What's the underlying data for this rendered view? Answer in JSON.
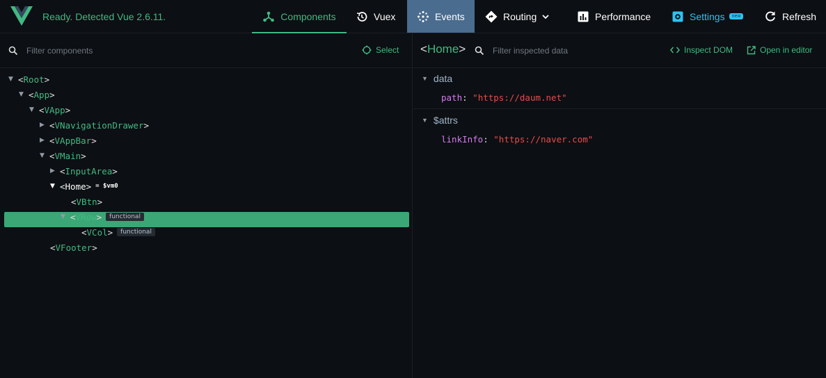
{
  "app": {
    "status": "Ready. Detected Vue 2.6.11."
  },
  "tabs": {
    "components": "Components",
    "vuex": "Vuex",
    "events": "Events",
    "routing": "Routing",
    "performance": "Performance",
    "settings": "Settings",
    "settings_badge": "new",
    "refresh": "Refresh"
  },
  "tree_panel": {
    "filter_placeholder": "Filter components",
    "select_label": "Select"
  },
  "tree": [
    {
      "name": "Root",
      "expanded": true
    },
    {
      "name": "App",
      "expanded": true
    },
    {
      "name": "VApp",
      "expanded": true
    },
    {
      "name": "VNavigationDrawer",
      "expanded": false
    },
    {
      "name": "VAppBar",
      "expanded": false
    },
    {
      "name": "VMain",
      "expanded": true
    },
    {
      "name": "InputArea",
      "expanded": false
    },
    {
      "name": "Home",
      "expanded": true,
      "selected": true,
      "vm": "= $vm0"
    },
    {
      "name": "VBtn"
    },
    {
      "name": "VRow",
      "expanded": true,
      "tag": "functional"
    },
    {
      "name": "VCol",
      "tag": "functional"
    },
    {
      "name": "VFooter"
    }
  ],
  "inspector": {
    "component": "Home",
    "filter_placeholder": "Filter inspected data",
    "inspect_dom": "Inspect DOM",
    "open_editor": "Open in editor",
    "sections": [
      {
        "title": "data",
        "props": [
          {
            "key": "path",
            "value": "\"https://daum.net\""
          }
        ]
      },
      {
        "title": "$attrs",
        "props": [
          {
            "key": "linkInfo",
            "value": "\"https://naver.com\""
          }
        ]
      }
    ]
  },
  "colors": {
    "accent": "#42b983",
    "selected_row": "#3ba776",
    "events_bg": "#4a6c8f",
    "settings": "#2ec1f0",
    "background": "#0c0f13"
  }
}
